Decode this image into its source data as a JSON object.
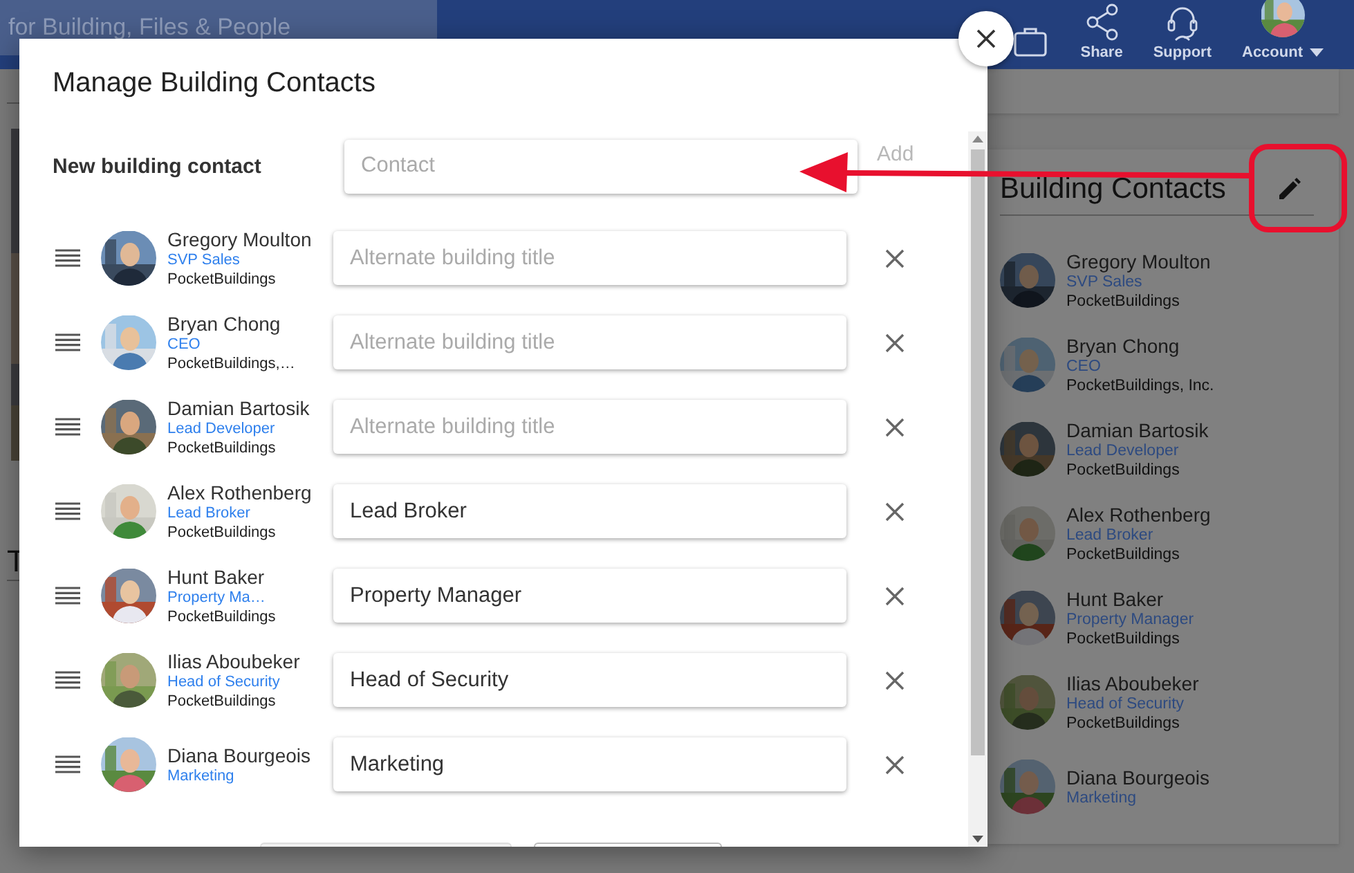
{
  "header": {
    "search": {
      "placeholder": "for Building, Files & People"
    },
    "actions": [
      {
        "kind": "briefcase"
      },
      {
        "kind": "share",
        "label": "Share"
      },
      {
        "kind": "headset",
        "label": "Support"
      }
    ],
    "account": {
      "label": "Account"
    }
  },
  "page": {
    "headings": [
      "T"
    ]
  },
  "contacts_panel": {
    "title": "Building Contacts",
    "contacts": [
      {
        "name": "Gregory Moulton",
        "title": "SVP Sales",
        "company": "PocketBuildings"
      },
      {
        "name": "Bryan Chong",
        "title": "CEO",
        "company": "PocketBuildings, Inc."
      },
      {
        "name": "Damian Bartosik",
        "title": "Lead Developer",
        "company": "PocketBuildings"
      },
      {
        "name": "Alex Rothenberg",
        "title": "Lead Broker",
        "company": "PocketBuildings"
      },
      {
        "name": "Hunt Baker",
        "title": "Property Manager",
        "company": "PocketBuildings"
      },
      {
        "name": "Ilias Aboubeker",
        "title": "Head of Security",
        "company": "PocketBuildings"
      },
      {
        "name": "Diana Bourgeois",
        "title": "Marketing"
      }
    ]
  },
  "dialog": {
    "title": "Manage Building Contacts",
    "new_contact": {
      "label": "New building contact",
      "placeholder": "Contact",
      "add_label": "Add",
      "add_disabled": true
    },
    "contacts": [
      {
        "name": "Gregory Moulton",
        "title": "SVP Sales",
        "company": "PocketBuildings",
        "field": {
          "placeholder": "Alternate building title"
        }
      },
      {
        "name": "Bryan Chong",
        "title": "CEO",
        "company": "PocketBuildings,…",
        "field": {
          "placeholder": "Alternate building title"
        }
      },
      {
        "name": "Damian Bartosik",
        "title": "Lead Developer",
        "company": "PocketBuildings",
        "field": {
          "placeholder": "Alternate building title"
        }
      },
      {
        "name": "Alex Rothenberg",
        "title": "Lead Broker",
        "company": "PocketBuildings",
        "field": {
          "value": "Lead Broker"
        }
      },
      {
        "name": "Hunt Baker",
        "title": "Property Ma…",
        "company": "PocketBuildings",
        "field": {
          "value": "Property Manager"
        }
      },
      {
        "name": "Ilias Aboubeker",
        "title": "Head of Security",
        "company": "PocketBuildings",
        "field": {
          "value": "Head of Security"
        }
      },
      {
        "name": "Diana Bourgeois",
        "title": "Marketing",
        "field": {
          "value": "Marketing"
        }
      }
    ]
  }
}
